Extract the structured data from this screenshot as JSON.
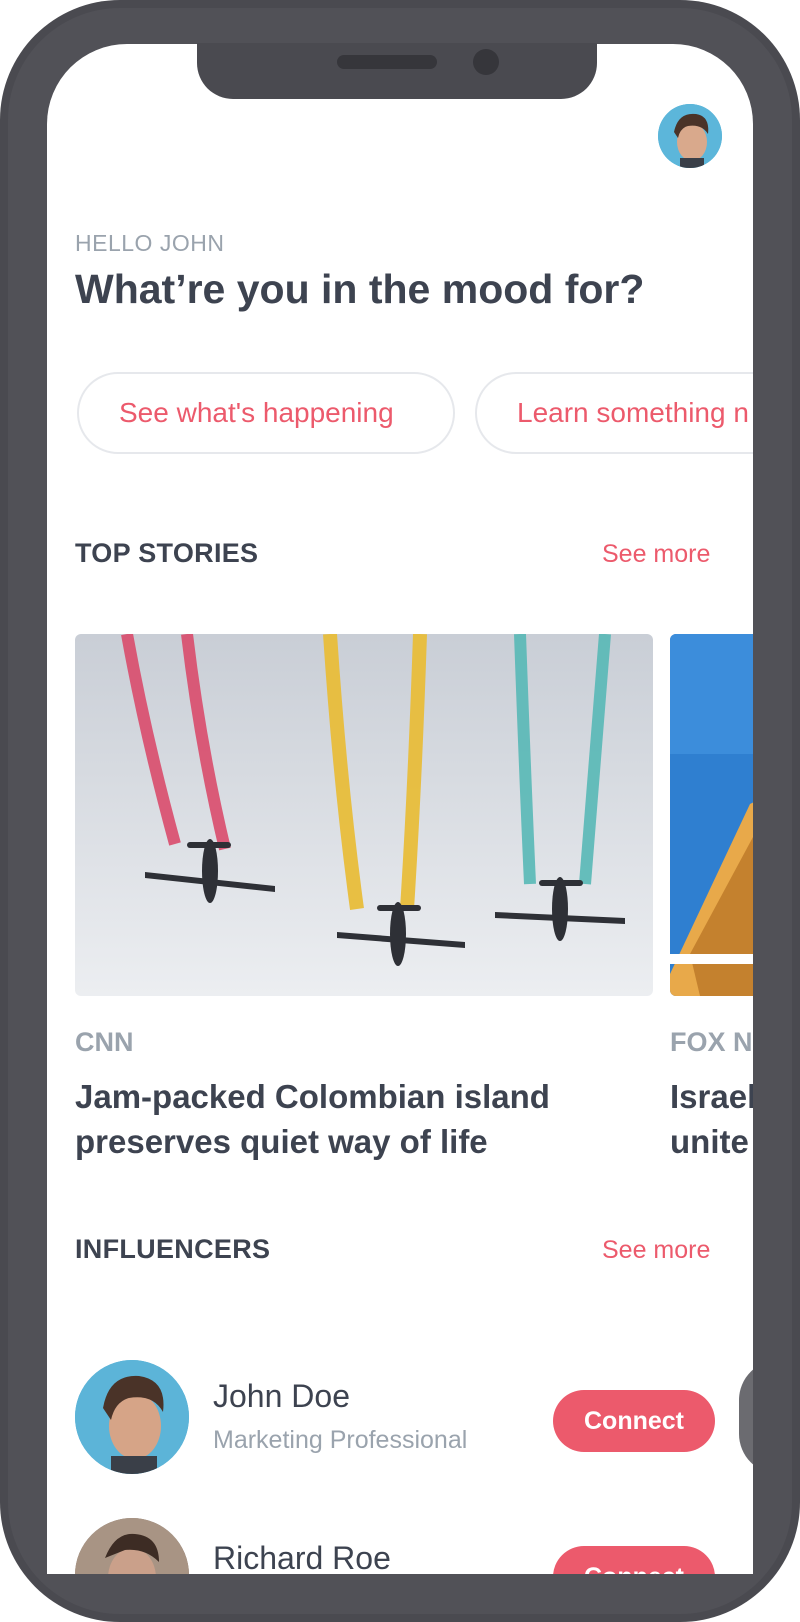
{
  "greeting": "HELLO JOHN",
  "headline": "What’re you in the mood for?",
  "moods": [
    {
      "label": "See what's happening"
    },
    {
      "label": "Learn something n"
    }
  ],
  "top_stories": {
    "title": "TOP STORIES",
    "see_more": "See more",
    "stories": [
      {
        "source": "CNN",
        "title_line1": "Jam-packed Colombian island",
        "title_line2": "preserves quiet way of life"
      },
      {
        "source": "FOX N",
        "title_line1": "Israel",
        "title_line2": "unite"
      }
    ]
  },
  "influencers": {
    "title": "INFLUENCERS",
    "see_more": "See more",
    "people": [
      {
        "name": "John Doe",
        "role": "Marketing Professional",
        "action": "Connect"
      },
      {
        "name": "Richard Roe",
        "role": "",
        "action": "Connect"
      }
    ]
  },
  "colors": {
    "accent": "#ec5a6c",
    "text_dark": "#3d4350",
    "text_muted": "#9aa3ad",
    "frame": "#4a4a50"
  }
}
